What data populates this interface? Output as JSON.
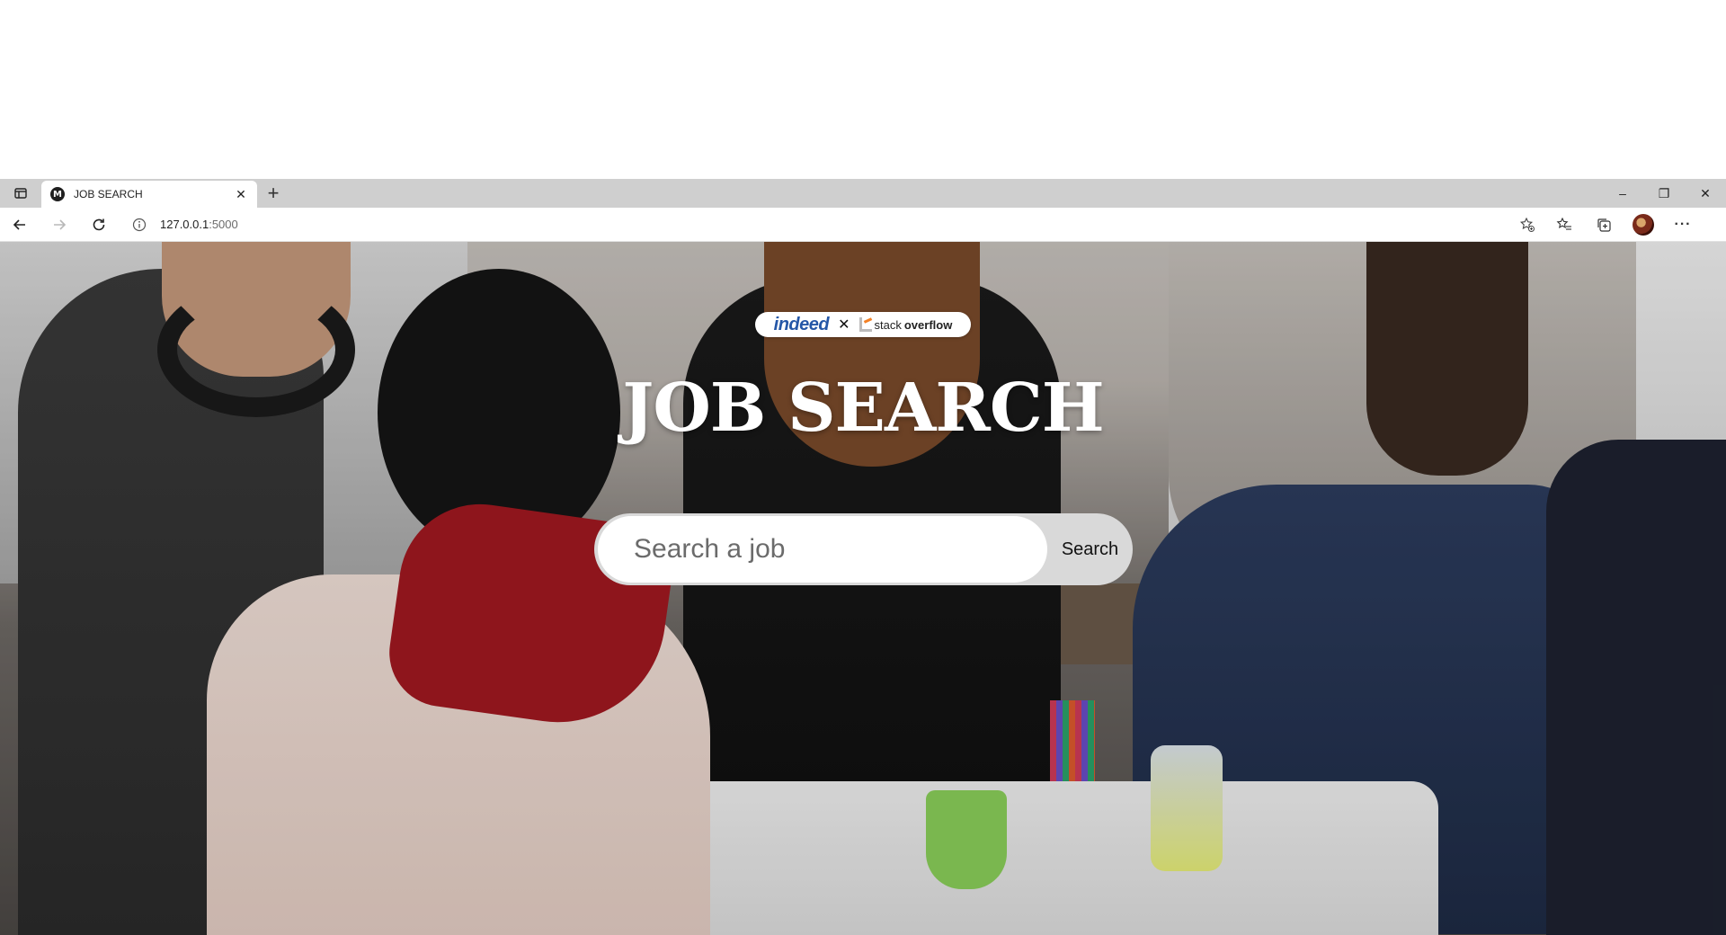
{
  "browser": {
    "tab": {
      "title": "JOB SEARCH",
      "favicon_letter": "M"
    },
    "address": {
      "host": "127.0.0.1",
      "port": ":5000"
    },
    "icons": {
      "tab_actions": "tab-actions-icon",
      "close_tab": "close-icon",
      "new_tab": "plus-icon",
      "back": "back-arrow-icon",
      "forward": "forward-arrow-icon",
      "reload": "reload-icon",
      "site_info": "info-icon",
      "add_favorite": "star-plus-icon",
      "favorites": "favorites-icon",
      "collections": "collections-icon",
      "profile": "avatar",
      "menu": "more-icon",
      "minimize": "minimize-icon",
      "restore": "restore-icon",
      "close_window": "close-icon"
    },
    "window_controls": {
      "minimize": "–",
      "restore": "❐",
      "close": "✕"
    },
    "nav_glyphs": {
      "back": "←",
      "forward": "→",
      "reload": "↻",
      "menu": "···",
      "new_tab": "+",
      "close_tab": "✕"
    }
  },
  "page": {
    "badge": {
      "indeed": "indeed",
      "separator": "✕",
      "so_light": "stack",
      "so_bold": "overflow"
    },
    "title": "JOB SEARCH",
    "search": {
      "placeholder": "Search a job",
      "button_label": "Search"
    }
  }
}
